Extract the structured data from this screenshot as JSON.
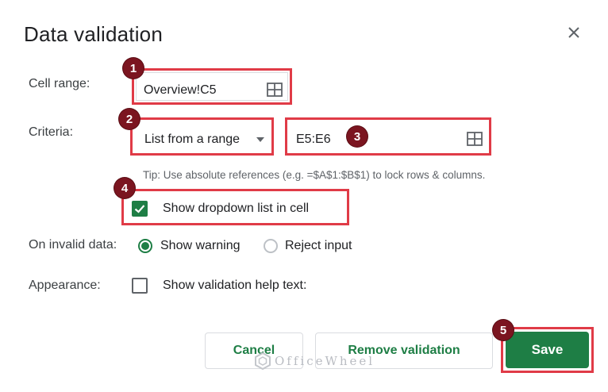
{
  "dialog": {
    "title": "Data validation",
    "close_icon": "close-icon"
  },
  "cell_range": {
    "label": "Cell range:",
    "value": "Overview!C5",
    "icon": "grid-select-icon"
  },
  "criteria": {
    "label": "Criteria:",
    "type_value": "List from a range",
    "range_value": "E5:E6",
    "icon": "grid-select-icon"
  },
  "tip": "Tip: Use absolute references (e.g. =$A$1:$B$1) to lock rows & columns.",
  "show_dropdown": {
    "label": "Show dropdown list in cell",
    "checked": true
  },
  "invalid_data": {
    "label": "On invalid data:",
    "options": [
      {
        "label": "Show warning",
        "selected": true
      },
      {
        "label": "Reject input",
        "selected": false
      }
    ]
  },
  "appearance": {
    "label": "Appearance:",
    "help_text_label": "Show validation help text:",
    "checked": false
  },
  "buttons": {
    "cancel": "Cancel",
    "remove": "Remove validation",
    "save": "Save"
  },
  "badges": [
    "1",
    "2",
    "3",
    "4",
    "5"
  ],
  "watermark": "OfficeWheel",
  "colors": {
    "accent": "#1e7e45",
    "highlight": "#e03b47",
    "badge": "#7b1520"
  }
}
